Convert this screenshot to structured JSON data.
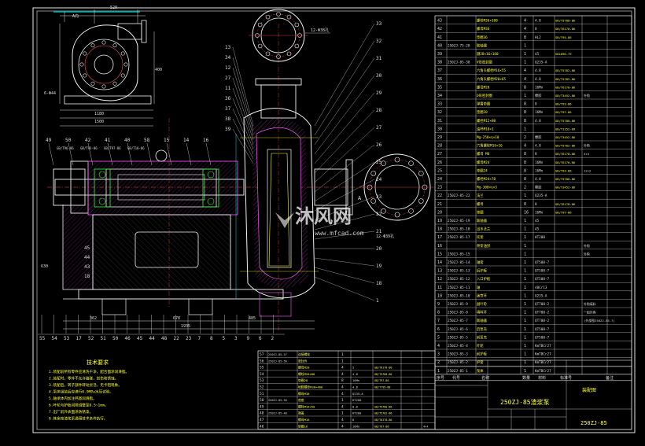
{
  "drawing": {
    "title_block_name": "250ZJ-85渣浆泵",
    "title_block_code": "250ZJ-85",
    "title_block_label": "装配图",
    "headers": [
      "序号",
      "代号",
      "名称",
      "数量",
      "材料",
      "标准号",
      "备注"
    ],
    "notes_title": "技术要求",
    "notes": [
      "1.装配前所有零件应清洗干净，配合面涂润滑脂。",
      "2.装配时，零件不允许磕碰，划伤和锈蚀。",
      "3.装配后，转子部件转动灵活，无卡阻现象。",
      "4.泵体组装后应进行0.9MPa水压试验。",
      "5.轴承体内加注钙基润滑脂。",
      "6.叶轮与护板间隙调整至0.5~1mm。",
      "7.出厂前外表面涂防锈漆。",
      "8.其余按渣浆泵通用技术条件执行。"
    ],
    "watermark": "沐风网",
    "watermark_url": "www.mfcad.com",
    "section_label": "A",
    "view_label": "A向",
    "dims_top": [
      "520",
      "1180",
      "1500",
      "1116",
      "962",
      "6-Φ44",
      "400",
      "1040",
      "170"
    ],
    "dims_bottom": [
      "362",
      "678",
      "1935",
      "485",
      "630"
    ],
    "flange_labels": [
      "12-Φ38孔",
      "12-Φ39孔"
    ],
    "left_callouts": [
      "49",
      "50",
      "42",
      "41",
      "40",
      "58",
      "15",
      "14",
      "16"
    ],
    "left_callout_subs": [
      "GB/T96-86",
      "GB/T93-86",
      "GB/T97-86",
      "GB/T10-86"
    ],
    "bottom_callouts": [
      "55",
      "54",
      "53",
      "17",
      "52",
      "51",
      "50",
      "46",
      "45",
      "44",
      "48",
      "22",
      "23",
      "7",
      "8",
      "5",
      "3",
      "9",
      "6",
      "2"
    ],
    "left_side_callouts": [
      "45",
      "44",
      "43",
      "18"
    ],
    "right_callouts": [
      "33",
      "32",
      "31",
      "30",
      "29",
      "28",
      "27",
      "26",
      "25",
      "24",
      "23",
      "22",
      "21",
      "20",
      "19",
      "18",
      "1"
    ],
    "mid_callouts": [
      "13",
      "34",
      "12",
      "27",
      "11",
      "36",
      "37",
      "38",
      "39"
    ],
    "parts": [
      {
        "no": "43",
        "code": "",
        "name": "螺栓M36×100",
        "qty": "4",
        "mat": "4.8",
        "std": "GB/T5780-86",
        "note": ""
      },
      {
        "no": "42",
        "code": "",
        "name": "螺母M36",
        "qty": "4",
        "mat": "8",
        "std": "GB/T6170-86",
        "note": ""
      },
      {
        "no": "41",
        "code": "",
        "name": "垫圈36",
        "qty": "8",
        "mat": "HL2",
        "std": "GB/T95-86",
        "note": ""
      },
      {
        "no": "40",
        "code": "250ZJ-75-28",
        "name": "联轴器",
        "qty": "1",
        "mat": "",
        "std": "",
        "note": ""
      },
      {
        "no": "39",
        "code": "",
        "name": "键28×16×160",
        "qty": "1",
        "mat": "45",
        "std": "GB1096-79",
        "note": ""
      },
      {
        "no": "38",
        "code": "250ZJ-85-38",
        "name": "V形密封圈",
        "qty": "1",
        "mat": "Q235-A",
        "std": "",
        "note": ""
      },
      {
        "no": "37",
        "code": "",
        "name": "六角头螺栓M16×55",
        "qty": "4",
        "mat": "4.8",
        "std": "GB/T5782-86",
        "note": ""
      },
      {
        "no": "36",
        "code": "",
        "name": "六角头螺栓M20×65",
        "qty": "4",
        "mat": "4.8",
        "std": "GB/T5782-86",
        "note": ""
      },
      {
        "no": "35",
        "code": "",
        "name": "螺母M20",
        "qty": "8",
        "mat": "16Mn",
        "std": "GB/T6170-86",
        "note": ""
      },
      {
        "no": "34",
        "code": "",
        "name": "O形密封圈",
        "qty": "1",
        "mat": "橡胶",
        "std": "GB/T3452-86",
        "note": "外购"
      },
      {
        "no": "33",
        "code": "",
        "name": "弹簧垫圈",
        "qty": "8",
        "mat": "8",
        "std": "GB/T93-86",
        "note": ""
      },
      {
        "no": "32",
        "code": "",
        "name": "垫圈20",
        "qty": "8",
        "mat": "16Mn",
        "std": "GB/T97-86",
        "note": ""
      },
      {
        "no": "31",
        "code": "",
        "name": "螺栓M12×80",
        "qty": "8",
        "mat": "4.8",
        "std": "GB/T5780-86",
        "note": ""
      },
      {
        "no": "30",
        "code": "",
        "name": "油杯M10×1",
        "qty": "1",
        "mat": "",
        "std": "GB/T1152-89",
        "note": ""
      },
      {
        "no": "29",
        "code": "",
        "name": "Mg-250×η×10",
        "qty": "2",
        "mat": "橡胶",
        "std": "GB/T3452-86",
        "note": ""
      },
      {
        "no": "28",
        "code": "",
        "name": "六角螺栓M16×16",
        "qty": "4",
        "mat": "4.8",
        "std": "GB/T5782-86",
        "note": "外购"
      },
      {
        "no": "27",
        "code": "",
        "name": "螺母 M6",
        "qty": "8",
        "mat": "8",
        "std": "GB/T6170-86",
        "note": "4×4"
      },
      {
        "no": "26",
        "code": "",
        "name": "螺母M24",
        "qty": "8",
        "mat": "16Mn",
        "std": "GB/T6170-86",
        "note": ""
      },
      {
        "no": "25",
        "code": "",
        "name": "垫圈24",
        "qty": "8",
        "mat": "16Mn",
        "std": "GB/T93-86",
        "note": "12×2"
      },
      {
        "no": "24",
        "code": "",
        "name": "螺栓M24×70",
        "qty": "8",
        "mat": "4.8",
        "std": "GB/T5780-86",
        "note": ""
      },
      {
        "no": "23",
        "code": "",
        "name": "Mg-300×η×3",
        "qty": "2",
        "mat": "橡胶",
        "std": "GB/T3452-86",
        "note": ""
      },
      {
        "no": "22",
        "code": "250ZJ-85-22",
        "name": "法兰",
        "qty": "1",
        "mat": "Q235-A",
        "std": "",
        "note": ""
      },
      {
        "no": "21",
        "code": "",
        "name": "螺母",
        "qty": "8",
        "mat": "8",
        "std": "GB/T6170-86",
        "note": ""
      },
      {
        "no": "20",
        "code": "",
        "name": "垫圈",
        "qty": "16",
        "mat": "16Mn",
        "std": "GB/T97-86",
        "note": ""
      },
      {
        "no": "19",
        "code": "250ZJ-85-19",
        "name": "联轴器",
        "qty": "1",
        "mat": "45",
        "std": "",
        "note": ""
      },
      {
        "no": "18",
        "code": "250ZJ-85-18",
        "name": "出水法兰",
        "qty": "1",
        "mat": "45",
        "std": "",
        "note": ""
      },
      {
        "no": "17",
        "code": "250ZJ-85-17",
        "name": "托架",
        "qty": "1",
        "mat": "HT200",
        "std": "",
        "note": ""
      },
      {
        "no": "16",
        "code": "",
        "name": "骨架油封",
        "qty": "1",
        "mat": "",
        "std": "",
        "note": "外购"
      },
      {
        "no": "15",
        "code": "250ZJ-85-15",
        "name": "",
        "qty": "1",
        "mat": "",
        "std": "",
        "note": "外购"
      },
      {
        "no": "14",
        "code": "250ZJ-85-14",
        "name": "轴套",
        "qty": "1",
        "mat": "QT500-7",
        "std": "",
        "note": ""
      },
      {
        "no": "13",
        "code": "250ZJ-85-13",
        "name": "后护板",
        "qty": "1",
        "mat": "QT500-7",
        "std": "",
        "note": ""
      },
      {
        "no": "12",
        "code": "250ZJ-85-12",
        "name": "入口护板",
        "qty": "1",
        "mat": "QT500-7",
        "std": "",
        "note": ""
      },
      {
        "no": "11",
        "code": "250ZJ-85-11",
        "name": "轴",
        "qty": "1",
        "mat": "40Cr13",
        "std": "",
        "note": ""
      },
      {
        "no": "10",
        "code": "250ZJ-85-10",
        "name": "迷宫环",
        "qty": "1",
        "mat": "Q235-A",
        "std": "",
        "note": ""
      },
      {
        "no": "9",
        "code": "250ZJ-85-9",
        "name": "副叶轮",
        "qty": "1",
        "mat": "QT700-2",
        "std": "",
        "note": "外购填料"
      },
      {
        "no": "8",
        "code": "250ZJ-85-8",
        "name": "填料环",
        "qty": "1",
        "mat": "QT700-2",
        "std": "",
        "note": "一组外购"
      },
      {
        "no": "7",
        "code": "250ZJ-85-7",
        "name": "联轴器",
        "qty": "1",
        "mat": "QT700-2",
        "std": "",
        "note": "(外部图250ZJ-85-7)"
      },
      {
        "no": "6",
        "code": "250ZJ-85-6",
        "name": "后泵壳",
        "qty": "1",
        "mat": "QT500-7",
        "std": "",
        "note": ""
      },
      {
        "no": "5",
        "code": "250ZJ-85-5",
        "name": "前泵壳",
        "qty": "1",
        "mat": "QT500-7",
        "std": "",
        "note": ""
      },
      {
        "no": "4",
        "code": "250ZJ-85-4",
        "name": "叶轮",
        "qty": "1",
        "mat": "KmTBCr27",
        "std": "",
        "note": ""
      },
      {
        "no": "3",
        "code": "250ZJ-85-3",
        "name": "前护板",
        "qty": "1",
        "mat": "KmTBCr27",
        "std": "",
        "note": ""
      },
      {
        "no": "2",
        "code": "250ZJ-85-2",
        "name": "护套",
        "qty": "1",
        "mat": "KmTBCr27",
        "std": "",
        "note": ""
      },
      {
        "no": "1",
        "code": "250ZJ-85-1",
        "name": "泵体",
        "qty": "1",
        "mat": "KmTBCr27",
        "std": "",
        "note": ""
      }
    ],
    "parts_bottom": [
      {
        "no": "57",
        "code": "250ZJ-85-57",
        "name": "连接螺栓",
        "qty": "1",
        "mat": "",
        "std": "",
        "note": ""
      },
      {
        "no": "56",
        "code": "250ZJ-85-56",
        "name": "密封件",
        "qty": "1",
        "mat": "",
        "std": "",
        "note": ""
      },
      {
        "no": "55",
        "code": "",
        "name": "螺母M20",
        "qty": "4",
        "mat": "5",
        "std": "GB/T6170-86",
        "note": ""
      },
      {
        "no": "54",
        "code": "",
        "name": "螺栓M20×80",
        "qty": "4",
        "mat": "4.8",
        "std": "GB/T5780-86",
        "note": ""
      },
      {
        "no": "53",
        "code": "",
        "name": "垫圈20",
        "qty": "8",
        "mat": "16Mn",
        "std": "GB/T97-86",
        "note": ""
      },
      {
        "no": "52",
        "code": "",
        "name": "地脚螺栓M30×400",
        "qty": "4",
        "mat": "4.8",
        "std": "GB/T799-88",
        "note": ""
      },
      {
        "no": "51",
        "code": "",
        "name": "螺母M30",
        "qty": "4",
        "mat": "Q235-A",
        "std": "",
        "note": ""
      },
      {
        "no": "50",
        "code": "250ZJ-85-50",
        "name": "底座",
        "qty": "1",
        "mat": "HT200",
        "std": "",
        "note": ""
      },
      {
        "no": "49",
        "code": "",
        "name": "螺栓M16×50",
        "qty": "4",
        "mat": "8.8",
        "std": "GB/T5780-86",
        "note": ""
      },
      {
        "no": "48",
        "code": "250ZJ-85-48",
        "name": "端盖",
        "qty": "1",
        "mat": "HT200",
        "std": "GB/T5782-86",
        "note": ""
      },
      {
        "no": "47",
        "code": "",
        "name": "螺母M16",
        "qty": "4",
        "mat": "8",
        "std": "GB/T6170-86",
        "note": ""
      },
      {
        "no": "46",
        "code": "",
        "name": "垫圈16",
        "qty": "4",
        "mat": "16Mn",
        "std": "GB/T97-86",
        "note": "4×4"
      }
    ]
  }
}
